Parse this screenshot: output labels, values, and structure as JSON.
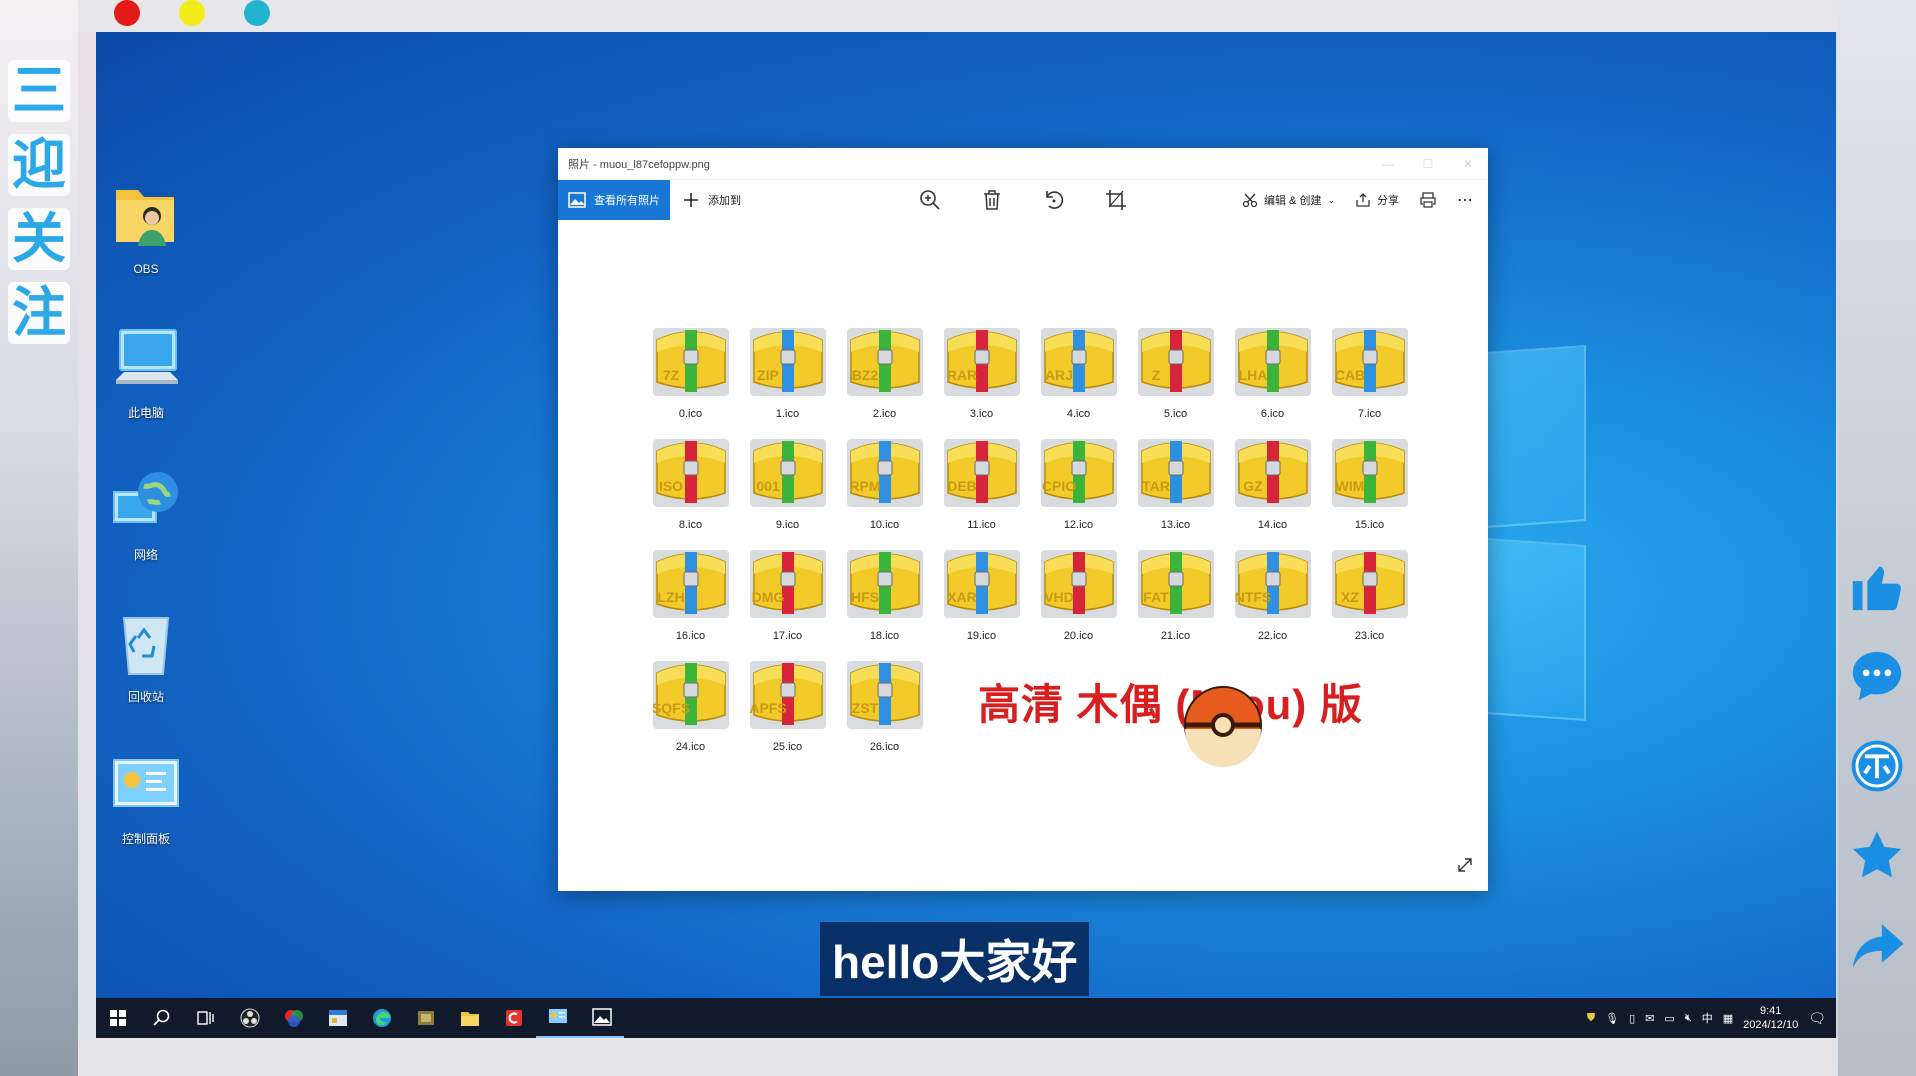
{
  "banner": {
    "chars": [
      "三",
      "迎",
      "关",
      "注"
    ]
  },
  "desktop": {
    "icons": [
      {
        "label": "OBS"
      },
      {
        "label": "此电脑"
      },
      {
        "label": "网络"
      },
      {
        "label": "回收站"
      },
      {
        "label": "控制面板"
      }
    ]
  },
  "photos_window": {
    "title": "照片 - muou_l87cefoppw.png",
    "toolbar": {
      "view_all": "查看所有照片",
      "add_to": "添加到",
      "edit_create": "编辑 & 创建",
      "share": "分享"
    },
    "files": [
      {
        "name": "0.ico",
        "label": "7Z",
        "strap": "#3cb43c"
      },
      {
        "name": "1.ico",
        "label": "ZIP",
        "strap": "#2f8fe0"
      },
      {
        "name": "2.ico",
        "label": "BZ2",
        "strap": "#3cb43c"
      },
      {
        "name": "3.ico",
        "label": "RAR",
        "strap": "#d8243a"
      },
      {
        "name": "4.ico",
        "label": "ARJ",
        "strap": "#2f8fe0"
      },
      {
        "name": "5.ico",
        "label": "Z",
        "strap": "#d8243a"
      },
      {
        "name": "6.ico",
        "label": "LHA",
        "strap": "#3cb43c"
      },
      {
        "name": "7.ico",
        "label": "CAB",
        "strap": "#2f8fe0"
      },
      {
        "name": "8.ico",
        "label": "ISO",
        "strap": "#d8243a"
      },
      {
        "name": "9.ico",
        "label": "001",
        "strap": "#3cb43c"
      },
      {
        "name": "10.ico",
        "label": "RPM",
        "strap": "#2f8fe0"
      },
      {
        "name": "11.ico",
        "label": "DEB",
        "strap": "#d8243a"
      },
      {
        "name": "12.ico",
        "label": "CPIO",
        "strap": "#3cb43c"
      },
      {
        "name": "13.ico",
        "label": "TAR",
        "strap": "#2f8fe0"
      },
      {
        "name": "14.ico",
        "label": "GZ",
        "strap": "#d8243a"
      },
      {
        "name": "15.ico",
        "label": "WIM",
        "strap": "#3cb43c"
      },
      {
        "name": "16.ico",
        "label": "LZH",
        "strap": "#2f8fe0"
      },
      {
        "name": "17.ico",
        "label": "DMG",
        "strap": "#d8243a"
      },
      {
        "name": "18.ico",
        "label": "HFS",
        "strap": "#3cb43c"
      },
      {
        "name": "19.ico",
        "label": "XAR",
        "strap": "#2f8fe0"
      },
      {
        "name": "20.ico",
        "label": "VHD",
        "strap": "#d8243a"
      },
      {
        "name": "21.ico",
        "label": "FAT",
        "strap": "#3cb43c"
      },
      {
        "name": "22.ico",
        "label": "NTFS",
        "strap": "#2f8fe0"
      },
      {
        "name": "23.ico",
        "label": "XZ",
        "strap": "#d8243a"
      },
      {
        "name": "24.ico",
        "label": "SQFS",
        "strap": "#3cb43c"
      },
      {
        "name": "25.ico",
        "label": "APFS",
        "strap": "#d8243a"
      },
      {
        "name": "26.ico",
        "label": "ZST",
        "strap": "#2f8fe0"
      }
    ],
    "overlay_text": "高清 木偶 (M ou) 版"
  },
  "subtitle": "hello大家好",
  "taskbar": {
    "time": "9:41",
    "date": "2024/12/10",
    "ime": "中"
  }
}
